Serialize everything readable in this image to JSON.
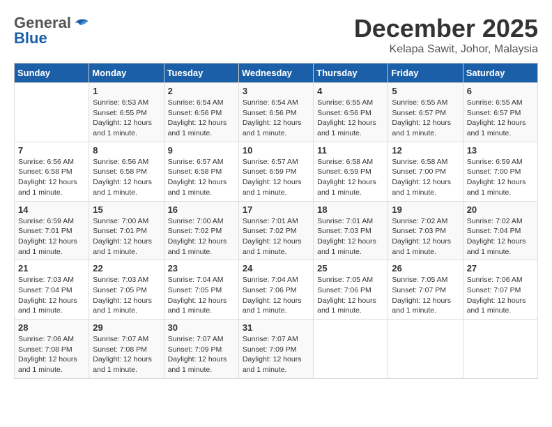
{
  "logo": {
    "general": "General",
    "blue": "Blue"
  },
  "header": {
    "month": "December 2025",
    "location": "Kelapa Sawit, Johor, Malaysia"
  },
  "days_of_week": [
    "Sunday",
    "Monday",
    "Tuesday",
    "Wednesday",
    "Thursday",
    "Friday",
    "Saturday"
  ],
  "weeks": [
    [
      {
        "day": "",
        "info": ""
      },
      {
        "day": "1",
        "info": "Sunrise: 6:53 AM\nSunset: 6:55 PM\nDaylight: 12 hours\nand 1 minute."
      },
      {
        "day": "2",
        "info": "Sunrise: 6:54 AM\nSunset: 6:56 PM\nDaylight: 12 hours\nand 1 minute."
      },
      {
        "day": "3",
        "info": "Sunrise: 6:54 AM\nSunset: 6:56 PM\nDaylight: 12 hours\nand 1 minute."
      },
      {
        "day": "4",
        "info": "Sunrise: 6:55 AM\nSunset: 6:56 PM\nDaylight: 12 hours\nand 1 minute."
      },
      {
        "day": "5",
        "info": "Sunrise: 6:55 AM\nSunset: 6:57 PM\nDaylight: 12 hours\nand 1 minute."
      },
      {
        "day": "6",
        "info": "Sunrise: 6:55 AM\nSunset: 6:57 PM\nDaylight: 12 hours\nand 1 minute."
      }
    ],
    [
      {
        "day": "7",
        "info": "Sunrise: 6:56 AM\nSunset: 6:58 PM\nDaylight: 12 hours\nand 1 minute."
      },
      {
        "day": "8",
        "info": "Sunrise: 6:56 AM\nSunset: 6:58 PM\nDaylight: 12 hours\nand 1 minute."
      },
      {
        "day": "9",
        "info": "Sunrise: 6:57 AM\nSunset: 6:58 PM\nDaylight: 12 hours\nand 1 minute."
      },
      {
        "day": "10",
        "info": "Sunrise: 6:57 AM\nSunset: 6:59 PM\nDaylight: 12 hours\nand 1 minute."
      },
      {
        "day": "11",
        "info": "Sunrise: 6:58 AM\nSunset: 6:59 PM\nDaylight: 12 hours\nand 1 minute."
      },
      {
        "day": "12",
        "info": "Sunrise: 6:58 AM\nSunset: 7:00 PM\nDaylight: 12 hours\nand 1 minute."
      },
      {
        "day": "13",
        "info": "Sunrise: 6:59 AM\nSunset: 7:00 PM\nDaylight: 12 hours\nand 1 minute."
      }
    ],
    [
      {
        "day": "14",
        "info": "Sunrise: 6:59 AM\nSunset: 7:01 PM\nDaylight: 12 hours\nand 1 minute."
      },
      {
        "day": "15",
        "info": "Sunrise: 7:00 AM\nSunset: 7:01 PM\nDaylight: 12 hours\nand 1 minute."
      },
      {
        "day": "16",
        "info": "Sunrise: 7:00 AM\nSunset: 7:02 PM\nDaylight: 12 hours\nand 1 minute."
      },
      {
        "day": "17",
        "info": "Sunrise: 7:01 AM\nSunset: 7:02 PM\nDaylight: 12 hours\nand 1 minute."
      },
      {
        "day": "18",
        "info": "Sunrise: 7:01 AM\nSunset: 7:03 PM\nDaylight: 12 hours\nand 1 minute."
      },
      {
        "day": "19",
        "info": "Sunrise: 7:02 AM\nSunset: 7:03 PM\nDaylight: 12 hours\nand 1 minute."
      },
      {
        "day": "20",
        "info": "Sunrise: 7:02 AM\nSunset: 7:04 PM\nDaylight: 12 hours\nand 1 minute."
      }
    ],
    [
      {
        "day": "21",
        "info": "Sunrise: 7:03 AM\nSunset: 7:04 PM\nDaylight: 12 hours\nand 1 minute."
      },
      {
        "day": "22",
        "info": "Sunrise: 7:03 AM\nSunset: 7:05 PM\nDaylight: 12 hours\nand 1 minute."
      },
      {
        "day": "23",
        "info": "Sunrise: 7:04 AM\nSunset: 7:05 PM\nDaylight: 12 hours\nand 1 minute."
      },
      {
        "day": "24",
        "info": "Sunrise: 7:04 AM\nSunset: 7:06 PM\nDaylight: 12 hours\nand 1 minute."
      },
      {
        "day": "25",
        "info": "Sunrise: 7:05 AM\nSunset: 7:06 PM\nDaylight: 12 hours\nand 1 minute."
      },
      {
        "day": "26",
        "info": "Sunrise: 7:05 AM\nSunset: 7:07 PM\nDaylight: 12 hours\nand 1 minute."
      },
      {
        "day": "27",
        "info": "Sunrise: 7:06 AM\nSunset: 7:07 PM\nDaylight: 12 hours\nand 1 minute."
      }
    ],
    [
      {
        "day": "28",
        "info": "Sunrise: 7:06 AM\nSunset: 7:08 PM\nDaylight: 12 hours\nand 1 minute."
      },
      {
        "day": "29",
        "info": "Sunrise: 7:07 AM\nSunset: 7:08 PM\nDaylight: 12 hours\nand 1 minute."
      },
      {
        "day": "30",
        "info": "Sunrise: 7:07 AM\nSunset: 7:09 PM\nDaylight: 12 hours\nand 1 minute."
      },
      {
        "day": "31",
        "info": "Sunrise: 7:07 AM\nSunset: 7:09 PM\nDaylight: 12 hours\nand 1 minute."
      },
      {
        "day": "",
        "info": ""
      },
      {
        "day": "",
        "info": ""
      },
      {
        "day": "",
        "info": ""
      }
    ]
  ]
}
